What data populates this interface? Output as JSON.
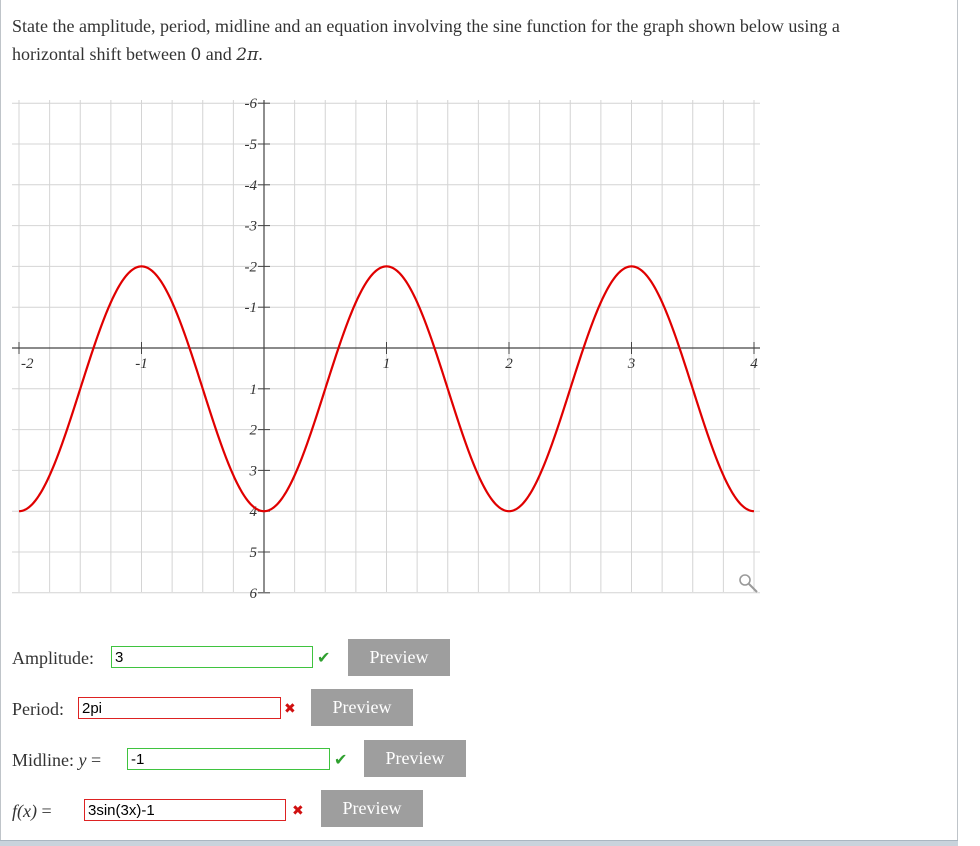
{
  "question": {
    "line1": "State the amplitude, period, midline and an equation involving the sine function for the graph shown below using a",
    "line2_prefix": "horizontal shift between ",
    "line2_zero": "0",
    "line2_and": " and ",
    "line2_twopi": "2π",
    "line2_end": "."
  },
  "graph": {
    "x_tick_labels": [
      "-2",
      "-1",
      "1",
      "2",
      "3",
      "4"
    ],
    "y_tick_labels": [
      "6",
      "5",
      "4",
      "3",
      "2",
      "1",
      "-1",
      "-2",
      "-3",
      "-4",
      "-5",
      "-6"
    ],
    "curve_color": "#e00000",
    "zoom_icon": "magnifier-icon"
  },
  "chart_data": {
    "type": "line",
    "xlim": [
      -2,
      4
    ],
    "ylim": [
      -6,
      6
    ],
    "grid": true,
    "x_ticks": [
      -2,
      -1,
      1,
      2,
      3,
      4
    ],
    "y_ticks": [
      -6,
      -5,
      -4,
      -3,
      -2,
      -1,
      1,
      2,
      3,
      4,
      5,
      6
    ],
    "series": [
      {
        "function": "3*sin(2*pi/2*(x+1.5)) - 1",
        "amplitude": 3,
        "period": 2,
        "midline": -1,
        "maxima_x": [
          -1,
          1,
          3
        ],
        "minima_x": [
          0,
          2
        ],
        "color": "#e00000"
      }
    ]
  },
  "answers": {
    "amplitude": {
      "label": "Amplitude:",
      "value": "3",
      "status": "correct",
      "preview": "Preview"
    },
    "period": {
      "label": "Period:",
      "value": "2pi",
      "status": "wrong",
      "preview": "Preview"
    },
    "midline": {
      "label": "Midline:",
      "label_var": "y",
      "label_eq": "=",
      "value": "-1",
      "status": "correct",
      "preview": "Preview"
    },
    "equation": {
      "label_fx": "f(x)",
      "label_eq": "=",
      "value": "3sin(3x)-1",
      "status": "wrong",
      "preview": "Preview"
    }
  },
  "marks": {
    "check": "✔",
    "cross": "✖"
  }
}
